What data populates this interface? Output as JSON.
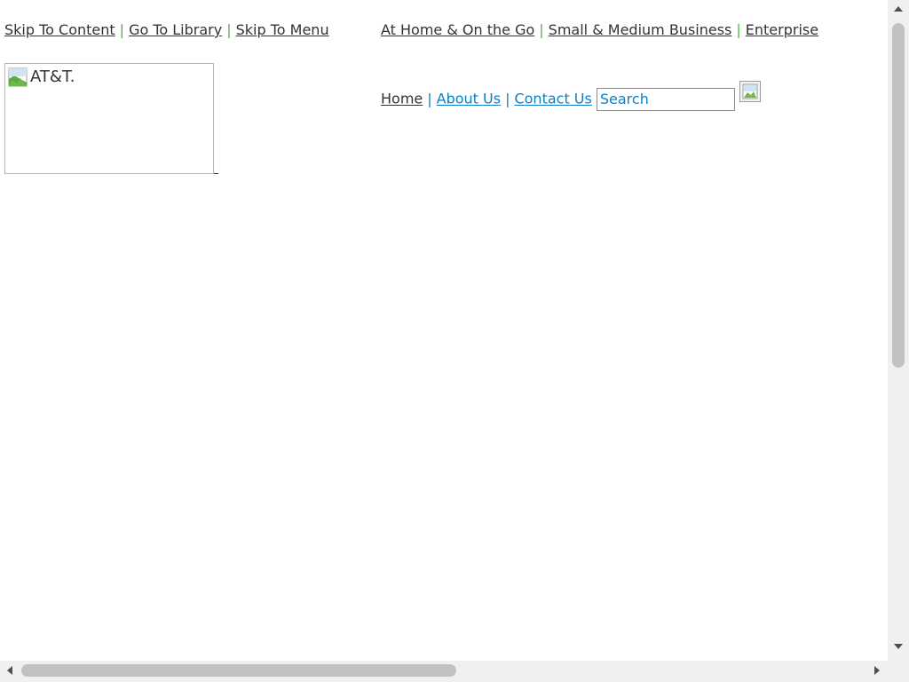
{
  "skip_nav": {
    "skip_to_content": "Skip To Content",
    "go_to_library": "Go To Library",
    "skip_to_menu": "Skip To Menu",
    "separator": "|"
  },
  "segments": {
    "home_on_the_go": "At Home & On the Go",
    "small_medium_business": "Small & Medium Business",
    "enterprise": "Enterprise",
    "separator": "|"
  },
  "logo": {
    "alt_text": "AT&T.",
    "icon": "broken-image-icon"
  },
  "utility_nav": {
    "home": "Home",
    "about_us": "About Us",
    "contact_us": "Contact Us",
    "separator": "|"
  },
  "search": {
    "value": "Search",
    "button_icon": "broken-image-icon"
  },
  "colors": {
    "link_dark": "#333333",
    "link_blue": "#0d7fc4",
    "separator_green": "#4bb548",
    "scrollbar_track": "#f0f0f0",
    "scrollbar_thumb": "#c1c1c1"
  }
}
